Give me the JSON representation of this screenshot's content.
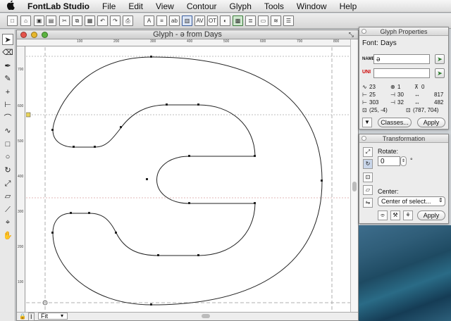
{
  "menubar": {
    "apple": "",
    "app": "FontLab Studio",
    "items": [
      "File",
      "Edit",
      "View",
      "Contour",
      "Glyph",
      "Tools",
      "Window",
      "Help"
    ]
  },
  "window": {
    "title": "Glyph - ə from Days"
  },
  "ruler": {
    "h": [
      "100",
      "200",
      "300",
      "400",
      "500",
      "600",
      "700",
      "800"
    ],
    "v": [
      "700",
      "600",
      "500",
      "400",
      "300",
      "200",
      "100"
    ]
  },
  "status": {
    "zoom": "Fit"
  },
  "glyph_properties": {
    "title": "Glyph Properties",
    "font_label": "Font:",
    "font_name": "Days",
    "name_label": "NAME",
    "name_value": "ə",
    "unicode_label": "UNI",
    "unicode_value": "",
    "metrics": {
      "nodes": "23",
      "contours": "1",
      "x": "0",
      "lsb": "25",
      "rsb": "30",
      "width": "817",
      "lsb2": "303",
      "rsb2": "32",
      "width2": "482",
      "bbox_min": "(25, -4)",
      "bbox_max": "(787, 704)"
    },
    "classes_btn": "Classes...",
    "apply_btn": "Apply"
  },
  "transformation": {
    "title": "Transformation",
    "rotate_label": "Rotate:",
    "rotate_value": "0",
    "degree": "°",
    "center_label": "Center:",
    "center_value": "Center of select...",
    "apply_btn": "Apply"
  }
}
